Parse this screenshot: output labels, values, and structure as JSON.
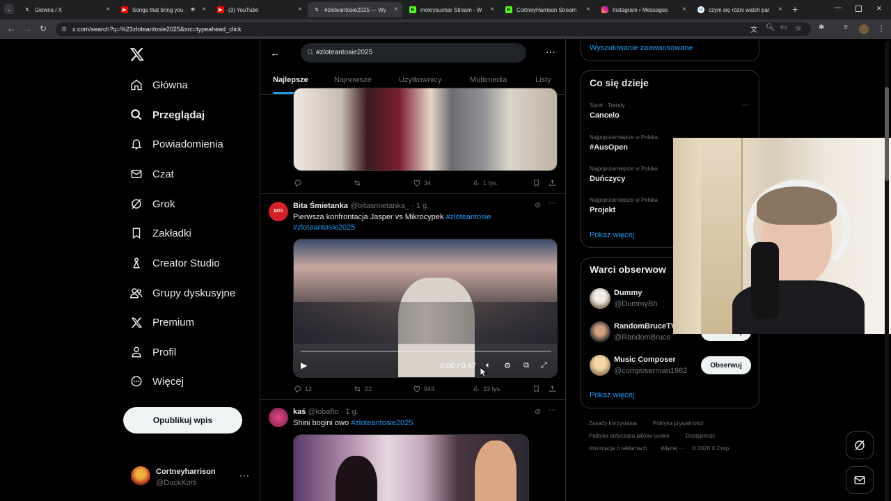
{
  "browser": {
    "tabs": [
      {
        "title": "Główna / X",
        "icon": "x-logo-icon"
      },
      {
        "title": "Songs that bring you",
        "icon": "youtube-icon"
      },
      {
        "title": "(3) YouTube",
        "icon": "youtube-icon"
      },
      {
        "title": "#złoteantosie2025 — Wy",
        "icon": "x-logo-icon"
      },
      {
        "title": "mokrysuchar Stream - W",
        "icon": "kick-icon"
      },
      {
        "title": "CortneyHarrison Stream",
        "icon": "kick-icon"
      },
      {
        "title": "Instagram • Messages",
        "icon": "instagram-icon"
      },
      {
        "title": "czym się różni watch par",
        "icon": "google-icon"
      }
    ],
    "url": "x.com/search?q=%23zloteantosie2025&src=typeahead_click"
  },
  "nav": {
    "items": [
      {
        "label": "Główna",
        "icon": "home-icon"
      },
      {
        "label": "Przeglądaj",
        "icon": "search-icon"
      },
      {
        "label": "Powiadomienia",
        "icon": "bell-icon"
      },
      {
        "label": "Czat",
        "icon": "mail-icon"
      },
      {
        "label": "Grok",
        "icon": "grok-icon"
      },
      {
        "label": "Zakładki",
        "icon": "bookmark-icon"
      },
      {
        "label": "Creator Studio",
        "icon": "creator-icon"
      },
      {
        "label": "Grupy dyskusyjne",
        "icon": "people-icon"
      },
      {
        "label": "Premium",
        "icon": "x-logo-icon"
      },
      {
        "label": "Profil",
        "icon": "person-icon"
      },
      {
        "label": "Więcej",
        "icon": "more-circle-icon"
      }
    ],
    "post_button": "Opublikuj wpis",
    "account": {
      "name": "Cortneyharrison",
      "handle": "@DuckKorti"
    }
  },
  "search": {
    "query": "#zloteantosie2025",
    "tabs": [
      "Najlepsze",
      "Najnowsze",
      "Użytkownicy",
      "Multimedia",
      "Listy"
    ]
  },
  "posts": [
    {
      "stats": {
        "replies": "",
        "reposts": "",
        "likes": "34",
        "views": "1 tys."
      }
    },
    {
      "author": "Bita Śmietanka",
      "handle": "@bitasmietanka_",
      "time": "· 1 g.",
      "text": "Pierwsza konfrontacja Jasper vs Mikrocypek",
      "tags": [
        "#zloteantosie",
        "#zloteantosie2025"
      ],
      "video_time": "0:00 / 0:47",
      "stats": {
        "replies": "12",
        "reposts": "22",
        "likes": "943",
        "views": "33 tys."
      }
    },
    {
      "author": "kaś",
      "handle": "@lobafto",
      "time": "· 1 g.",
      "text": "Shini bogini owo",
      "tags": [
        "#zloteantosie2025"
      ]
    }
  ],
  "sidebar": {
    "advanced_search": "Wyszukiwanie zaawansowane",
    "trends_title": "Co się dzieje",
    "trends": [
      {
        "category": "Sport · Trendy",
        "name": "Cancelo"
      },
      {
        "category": "Najpopularniejsze w Polska",
        "name": "#AusOpen"
      },
      {
        "category": "Najpopularniejsze w Polska",
        "name": "Duńczycy"
      },
      {
        "category": "Najpopularniejsze w Polska",
        "name": "Projekt"
      }
    ],
    "show_more": "Pokaż więcej",
    "who_title": "Warci obserwow",
    "who": [
      {
        "name": "Dummy",
        "handle": "@DummyBh"
      },
      {
        "name": "RandomBruceTV",
        "handle": "@RandomBruce",
        "button": "Obserwuj"
      },
      {
        "name": "Music Composer",
        "handle": "@composerman1982",
        "button": "Obserwuj"
      }
    ],
    "who_show_more": "Pokaż więcej",
    "footer": [
      "Zasady korzystania",
      "Polityka prywatności",
      "Polityka dotycząca plików cookie",
      "Dostępność",
      "Informacja o reklamach",
      "Więcej ···",
      "© 2026 X Corp."
    ]
  },
  "colors": {
    "accent": "#1d9bf0",
    "background": "#000000",
    "border": "#2f3336"
  }
}
